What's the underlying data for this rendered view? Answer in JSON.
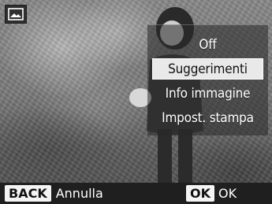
{
  "screen": {
    "icons": {
      "mode_icon": "image-icon"
    },
    "menu": {
      "items": [
        {
          "label": "Off",
          "selected": false
        },
        {
          "label": "Suggerimenti",
          "selected": true
        },
        {
          "label": "Info immagine",
          "selected": false
        },
        {
          "label": "Impost. stampa",
          "selected": false
        }
      ]
    },
    "footer": {
      "back_key": "BACK",
      "back_label": "Annulla",
      "ok_key": "OK",
      "ok_label": "OK"
    }
  }
}
